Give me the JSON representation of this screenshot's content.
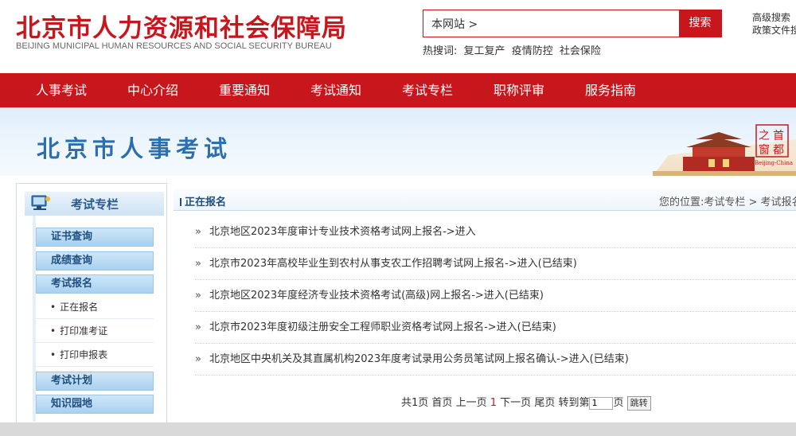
{
  "header": {
    "logo_cn": "北京市人力资源和社会保障局",
    "logo_en": "BEIJING MUNICIPAL HUMAN RESOURCES AND SOCIAL SECURITY BUREAU",
    "search_value": "本网站 >",
    "search_button": "搜索",
    "adv_search": "高级搜索",
    "policy_search": "政策文件搜",
    "hot_label": "热搜词:",
    "hot_words": [
      "复工复产",
      "疫情防控",
      "社会保险"
    ]
  },
  "nav": {
    "items": [
      "人事考试",
      "中心介绍",
      "重要通知",
      "考试通知",
      "考试专栏",
      "职称评审",
      "服务指南"
    ]
  },
  "banner": {
    "title": "北京市人事考试",
    "seal_top": "首",
    "seal_right": "之",
    "seal_bottom": "都",
    "seal_left": "窗",
    "seal_caption": "Beijing-China"
  },
  "sidebar": {
    "heading": "考试专栏",
    "cat_cert": "证书查询",
    "cat_score": "成绩查询",
    "cat_signup": "考试报名",
    "sub_items": [
      "正在报名",
      "打印准考证",
      "打印申报表"
    ],
    "cat_plan": "考试计划",
    "cat_knowledge": "知识园地"
  },
  "main": {
    "title": "正在报名",
    "breadcrumb": "您的位置:考试专栏 > 考试报名",
    "items": [
      "北京地区2023年度审计专业技术资格考试网上报名->进入",
      "北京市2023年高校毕业生到农村从事支农工作招聘考试网上报名->进入(已结束)",
      "北京地区2023年度经济专业技术资格考试(高级)网上报名->进入(已结束)",
      "北京市2023年度初级注册安全工程师职业资格考试网上报名->进入(已结束)",
      "北京地区中央机关及其直属机构2023年度考试录用公务员笔试网上报名确认->进入(已结束)"
    ]
  },
  "pager": {
    "total": "共1页",
    "first": "首页",
    "prev": "上一页",
    "current": "1",
    "next": "下一页",
    "last": "尾页",
    "goto_label": "转到第",
    "goto_value": "1",
    "page_unit": "页",
    "go_button": "跳转"
  },
  "colors": {
    "brand_red": "#c8161d",
    "link_blue": "#1f4f80"
  }
}
